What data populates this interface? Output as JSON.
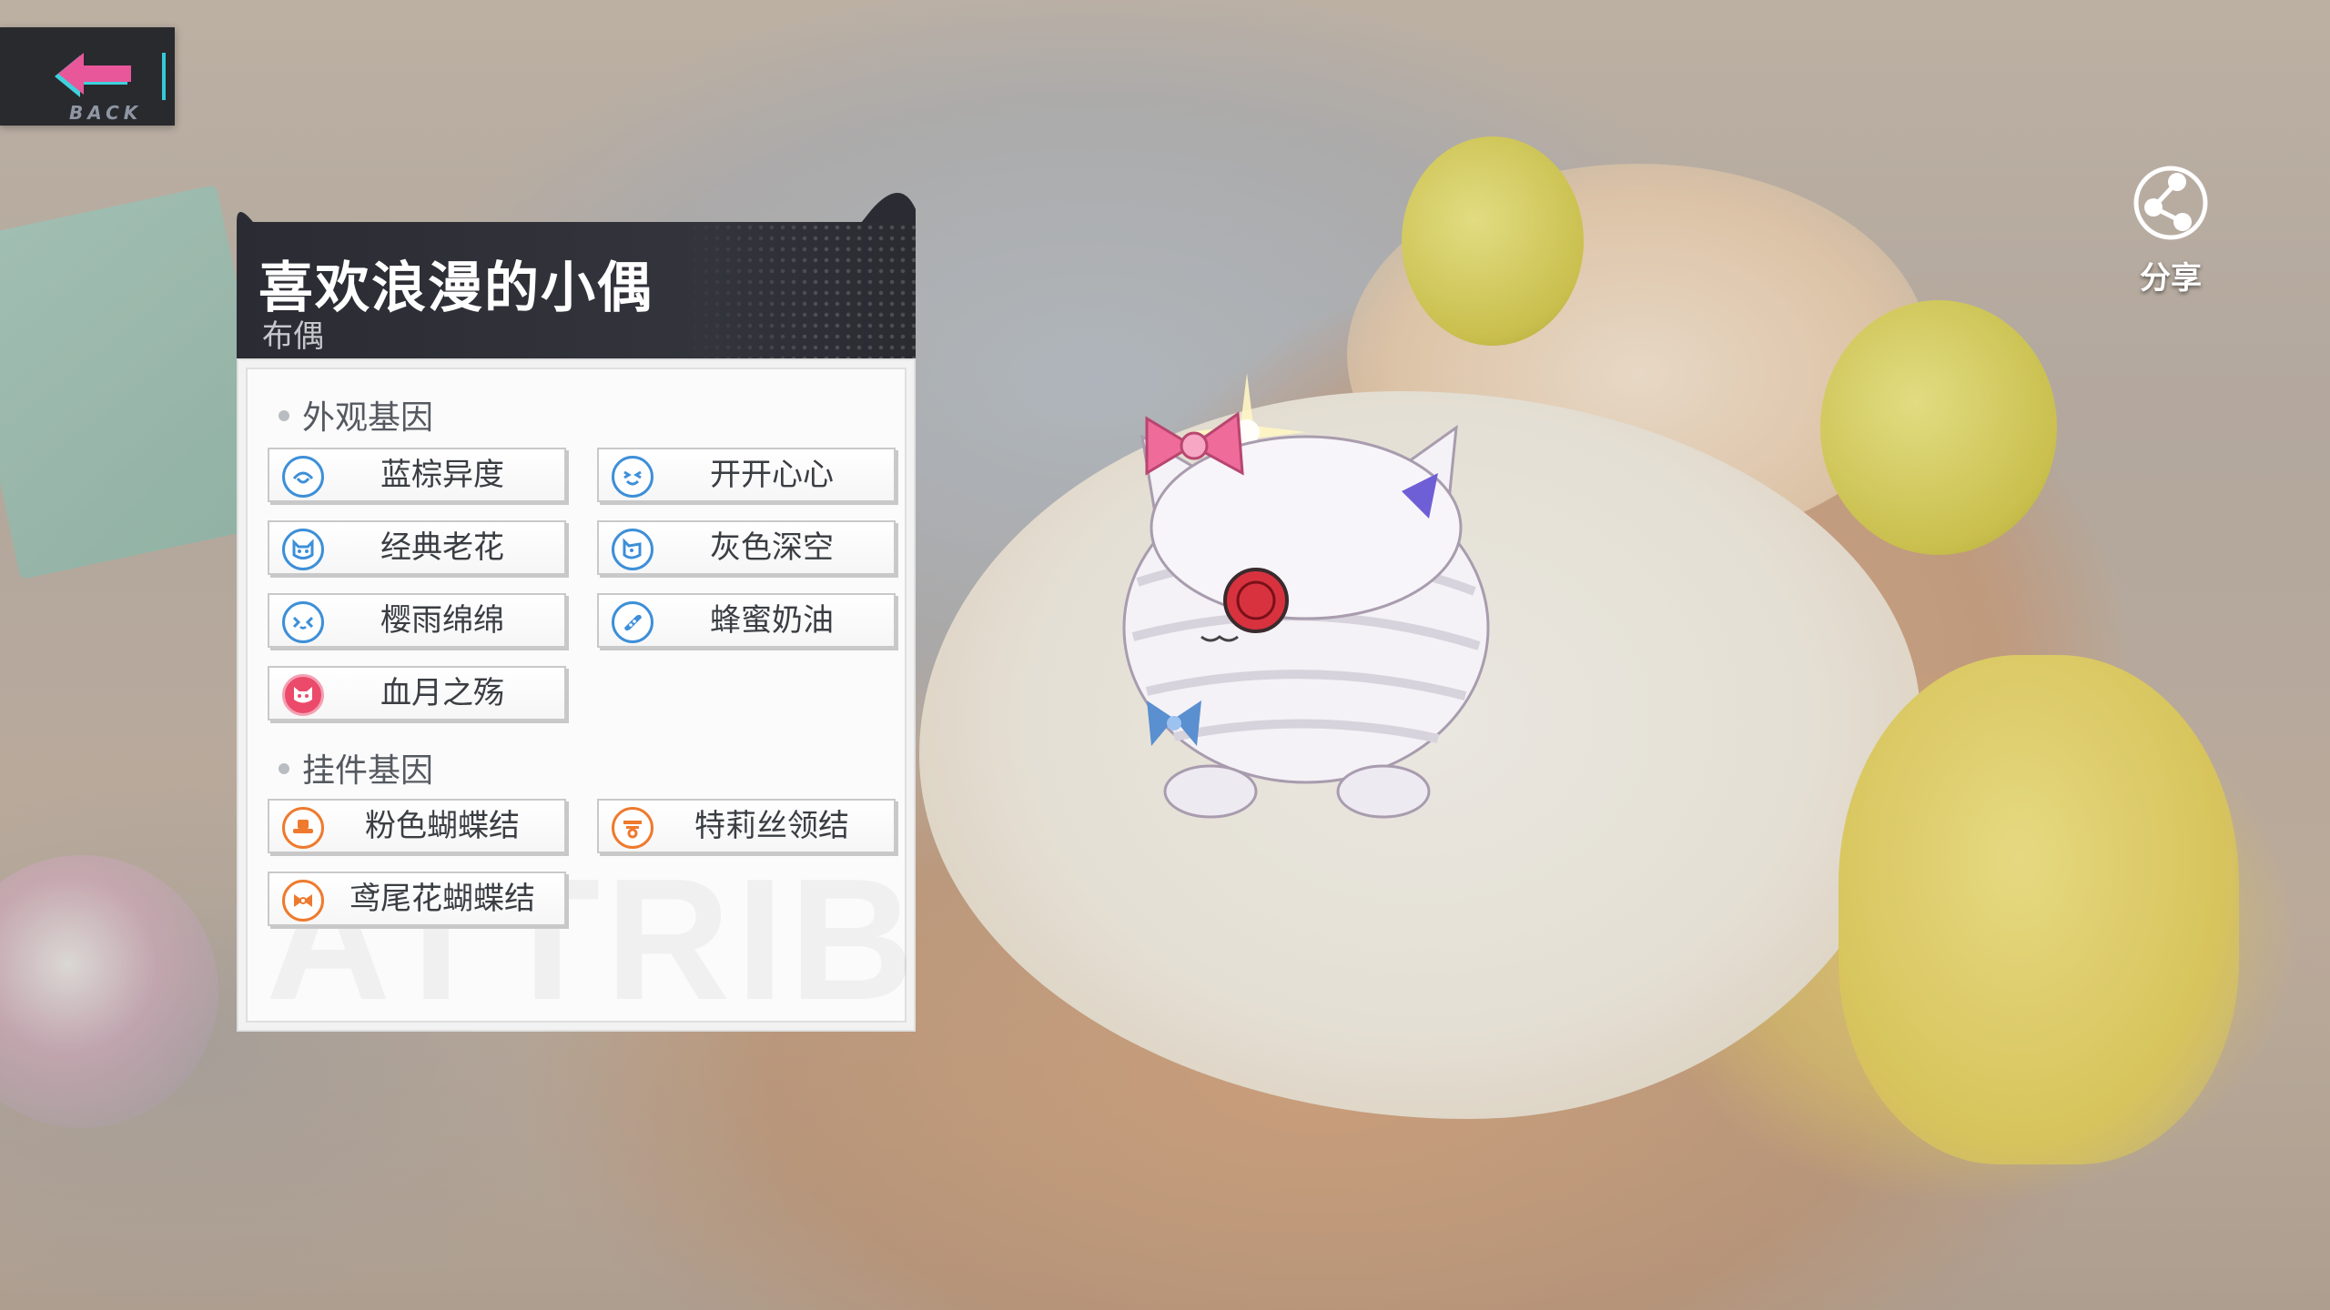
{
  "nav": {
    "back_label": "BACK",
    "share_label": "分享"
  },
  "panel": {
    "title": "喜欢浪漫的小偶",
    "subtitle": "布偶",
    "watermark": "ATTRIBU"
  },
  "appearance_genes": {
    "heading": "外观基因",
    "items": [
      {
        "label": "蓝棕异度",
        "icon": "heterochromia-eye-icon",
        "icon_color": "blue"
      },
      {
        "label": "开开心心",
        "icon": "happy-face-icon",
        "icon_color": "blue"
      },
      {
        "label": "经典老花",
        "icon": "classic-pattern-cat-icon",
        "icon_color": "blue"
      },
      {
        "label": "灰色深空",
        "icon": "gray-cat-face-icon",
        "icon_color": "blue"
      },
      {
        "label": "樱雨绵绵",
        "icon": "sakura-rain-icon",
        "icon_color": "blue"
      },
      {
        "label": "蜂蜜奶油",
        "icon": "honey-cream-icon",
        "icon_color": "blue"
      },
      {
        "label": "血月之殇",
        "icon": "blood-moon-cat-icon",
        "icon_color": "pink"
      }
    ]
  },
  "accessory_genes": {
    "heading": "挂件基因",
    "items": [
      {
        "label": "粉色蝴蝶结",
        "icon": "hat-bow-icon",
        "icon_color": "orange"
      },
      {
        "label": "特莉丝领结",
        "icon": "collar-tie-icon",
        "icon_color": "orange"
      },
      {
        "label": "鸢尾花蝴蝶结",
        "icon": "iris-bow-icon",
        "icon_color": "orange"
      }
    ]
  },
  "colors": {
    "panel_header": "#2b2c33",
    "accent_blue": "#3d8fd8",
    "accent_orange": "#ee7a2e",
    "accent_pink": "#ec4a6a",
    "back_arrow": "#e9579b",
    "back_bar": "#38c9d6"
  }
}
